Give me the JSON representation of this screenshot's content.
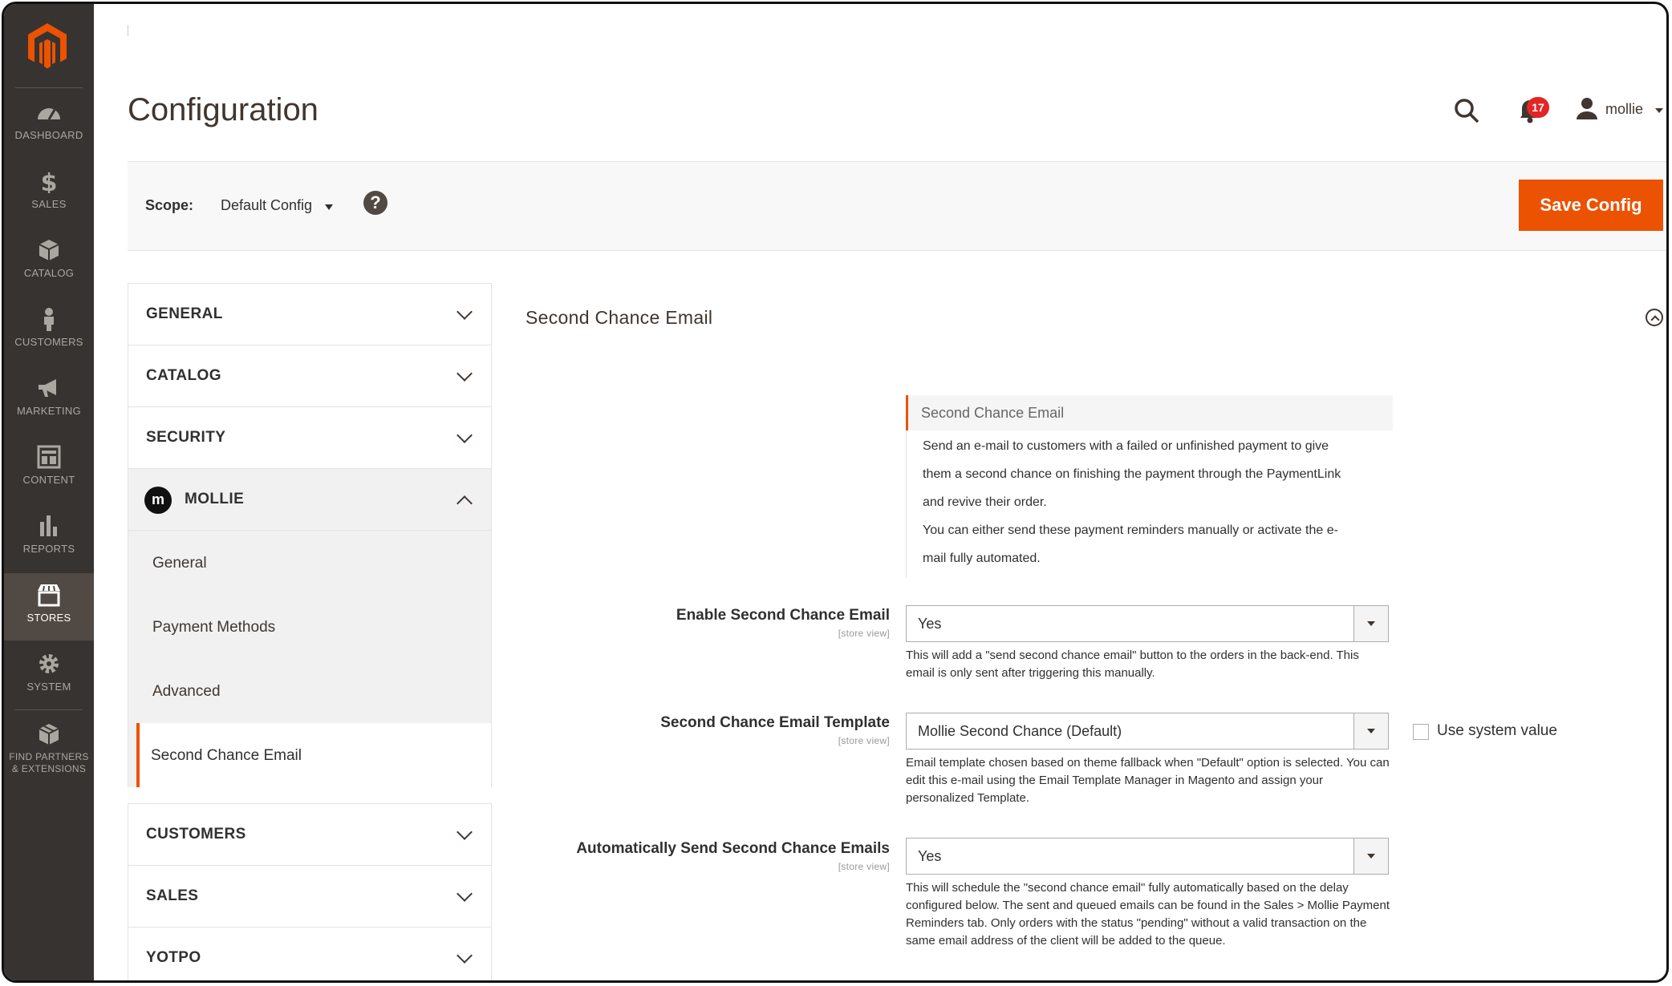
{
  "sidebar": {
    "items": [
      {
        "label": "DASHBOARD",
        "icon": "dashboard-icon"
      },
      {
        "label": "SALES",
        "icon": "dollar-icon"
      },
      {
        "label": "CATALOG",
        "icon": "box-icon"
      },
      {
        "label": "CUSTOMERS",
        "icon": "person-icon"
      },
      {
        "label": "MARKETING",
        "icon": "megaphone-icon"
      },
      {
        "label": "CONTENT",
        "icon": "layout-icon"
      },
      {
        "label": "REPORTS",
        "icon": "bar-chart-icon"
      },
      {
        "label": "STORES",
        "icon": "store-icon"
      },
      {
        "label": "SYSTEM",
        "icon": "gear-icon"
      },
      {
        "label": "FIND PARTNERS & EXTENSIONS",
        "icon": "extensions-icon"
      }
    ]
  },
  "header": {
    "title": "Configuration",
    "notifications": "17",
    "user": "mollie"
  },
  "scope": {
    "label": "Scope:",
    "value": "Default Config",
    "save_label": "Save Config"
  },
  "config_menu": {
    "sections_top": [
      "GENERAL",
      "CATALOG",
      "SECURITY"
    ],
    "open_section": "MOLLIE",
    "sub_items": [
      "General",
      "Payment Methods",
      "Advanced",
      "Second Chance Email"
    ],
    "sections_bottom": [
      "CUSTOMERS",
      "SALES",
      "YOTPO"
    ]
  },
  "main": {
    "section_title": "Second Chance Email",
    "info": {
      "heading": "Second Chance Email",
      "lines": [
        "Send an e-mail to customers with a failed or unfinished payment to give",
        "them a second chance on finishing the payment through the PaymentLink",
        "and revive their order.",
        "You can either send these payment reminders manually or activate the e-",
        "mail fully automated."
      ]
    },
    "fields": [
      {
        "label": "Enable Second Chance Email",
        "scope": "[store view]",
        "value": "Yes",
        "note": "This will add a \"send second chance email\" button to the orders in the back-end. This email is only sent after triggering this manually."
      },
      {
        "label": "Second Chance Email Template",
        "scope": "[store view]",
        "value": "Mollie Second Chance (Default)",
        "note": "Email template chosen based on theme fallback when \"Default\" option is selected. You can edit this e-mail using the Email Template Manager in Magento and assign your personalized Template.",
        "checkbox_label": "Use system value"
      },
      {
        "label": "Automatically Send Second Chance Emails",
        "scope": "[store view]",
        "value": "Yes",
        "note": "This will schedule the \"second chance email\" fully automatically based on the delay configured below. The sent and queued emails can be found in the Sales > Mollie Payment Reminders tab. Only orders with the status \"pending\" without a valid transaction on the same email address of the client will be added to the queue."
      }
    ]
  },
  "colors": {
    "sidebar_bg": "#373330",
    "accent": "#eb5202",
    "badge": "#e22626"
  }
}
